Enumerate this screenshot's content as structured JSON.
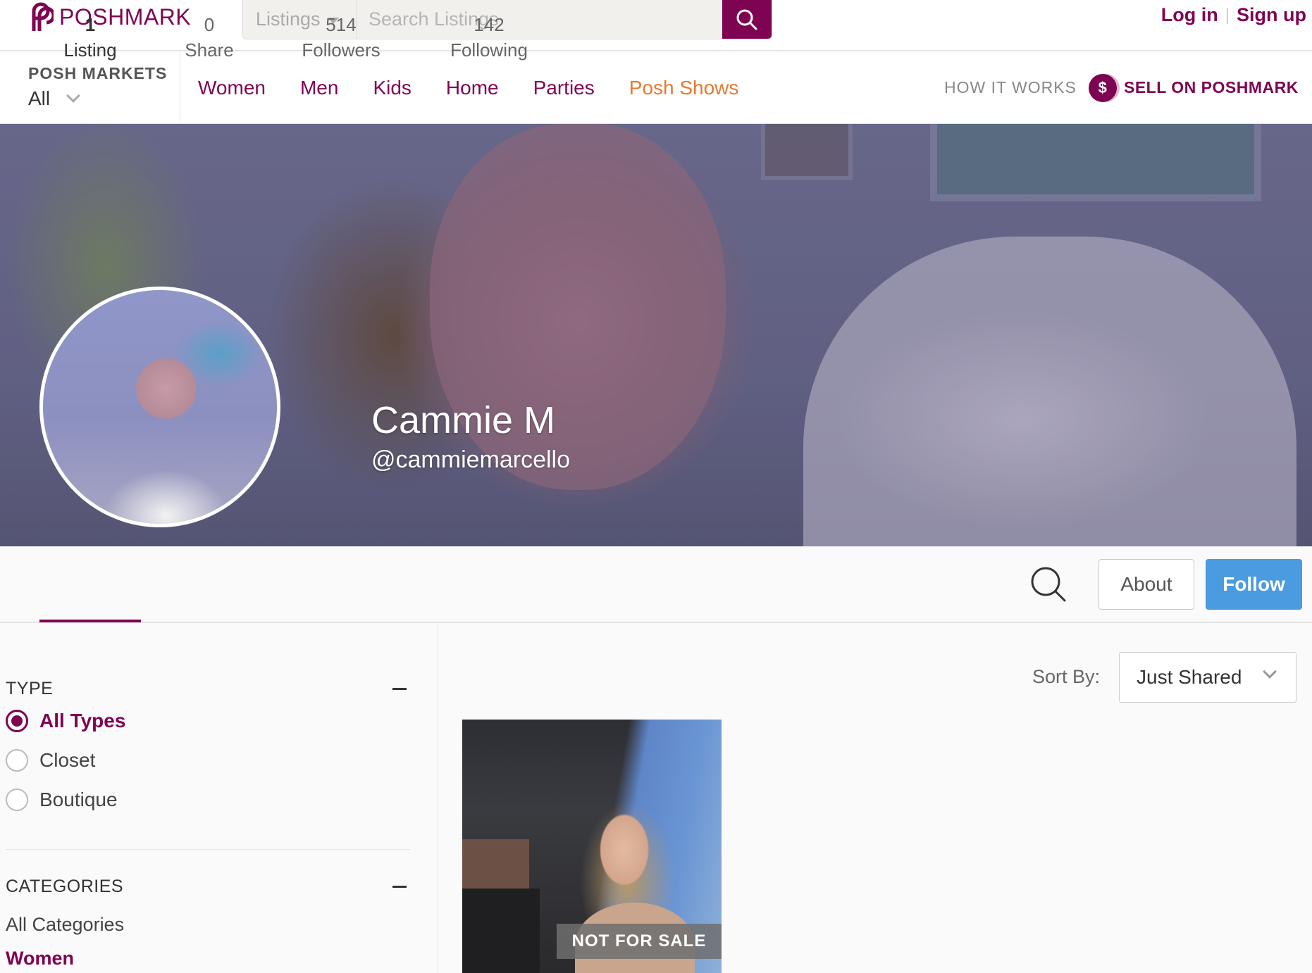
{
  "header": {
    "logo_text": "POSHMARK",
    "search_scope": "Listings",
    "search_placeholder": "Search Listings",
    "login_label": "Log in",
    "signup_label": "Sign up",
    "brand_color": "#7f0353"
  },
  "nav": {
    "markets_title": "POSH MARKETS",
    "markets_value": "All",
    "links": [
      "Women",
      "Men",
      "Kids",
      "Home",
      "Parties",
      "Posh Shows"
    ],
    "how_it_works": "HOW IT WORKS",
    "sell_label": "SELL ON POSHMARK",
    "sell_coin": "$"
  },
  "profile": {
    "name": "Cammie M",
    "handle": "@cammiemarcello"
  },
  "stats": [
    {
      "value": "1",
      "label": "Listing"
    },
    {
      "value": "0",
      "label": "Share"
    },
    {
      "value": "514",
      "label": "Followers"
    },
    {
      "value": "142",
      "label": "Following"
    }
  ],
  "actions": {
    "about_label": "About",
    "follow_label": "Follow",
    "follow_color": "#4a9be0"
  },
  "filters": {
    "type_title": "TYPE",
    "type_options": [
      "All Types",
      "Closet",
      "Boutique"
    ],
    "type_selected": "All Types",
    "categories_title": "CATEGORIES",
    "categories": [
      "All Categories",
      "Women"
    ]
  },
  "sort": {
    "label": "Sort By:",
    "value": "Just Shared"
  },
  "listing": {
    "badge": "NOT FOR SALE"
  }
}
